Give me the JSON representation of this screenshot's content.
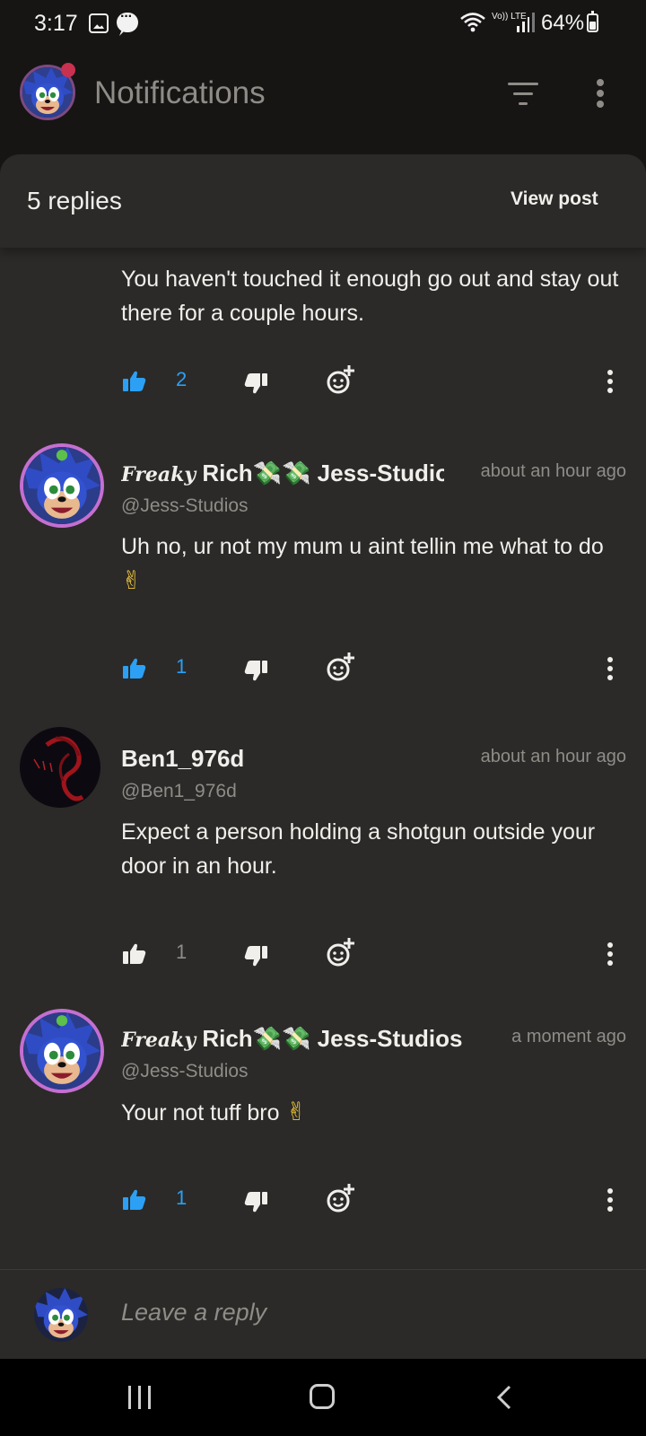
{
  "status_bar": {
    "time": "3:17",
    "battery": "64%",
    "network": "Vo)) LTE"
  },
  "app_bar": {
    "title": "Notifications"
  },
  "sheet": {
    "replies_label": "5 replies",
    "view_post_label": "View post"
  },
  "colors": {
    "background": "#161514",
    "sheet": "#2b2a28",
    "text": "#f0efeb",
    "muted": "#8f8c88",
    "accent_blue": "#2ba0f5",
    "icon_light": "#f0efeb"
  },
  "comments": [
    {
      "text": "You haven't touched it enough go out and stay out there for a couple hours.",
      "likes": "2",
      "liked": true
    },
    {
      "name_script": "Freaky",
      "name": "Rich💸💸 Jess-Studios",
      "handle": "@Jess-Studios",
      "time": "about an hour ago",
      "text": "Uh no, ur not my mum u aint tellin me what to do",
      "emoji": "✌",
      "likes": "1",
      "liked": true,
      "avatar_icon": "sonic-avatar-icon"
    },
    {
      "name": "Ben1_976d",
      "handle": "@Ben1_976d",
      "time": "about an hour ago",
      "text": "Expect a person holding a shotgun outside your door in an hour.",
      "likes": "1",
      "liked": false,
      "avatar_icon": "red-scribble-avatar-icon"
    },
    {
      "name_script": "Freaky",
      "name": "Rich💸💸 Jess-Studios",
      "handle": "@Jess-Studios",
      "time": "a moment ago",
      "text": "Your not tuff bro",
      "emoji": "✌",
      "likes": "1",
      "liked": true,
      "avatar_icon": "sonic-avatar-icon"
    }
  ],
  "reply_input": {
    "placeholder": "Leave a reply"
  },
  "icons": {
    "like": "thumb-up-icon",
    "dislike": "thumb-down-icon",
    "react": "emoji-add-icon",
    "more": "more-vert-icon",
    "filter": "filter-icon"
  }
}
